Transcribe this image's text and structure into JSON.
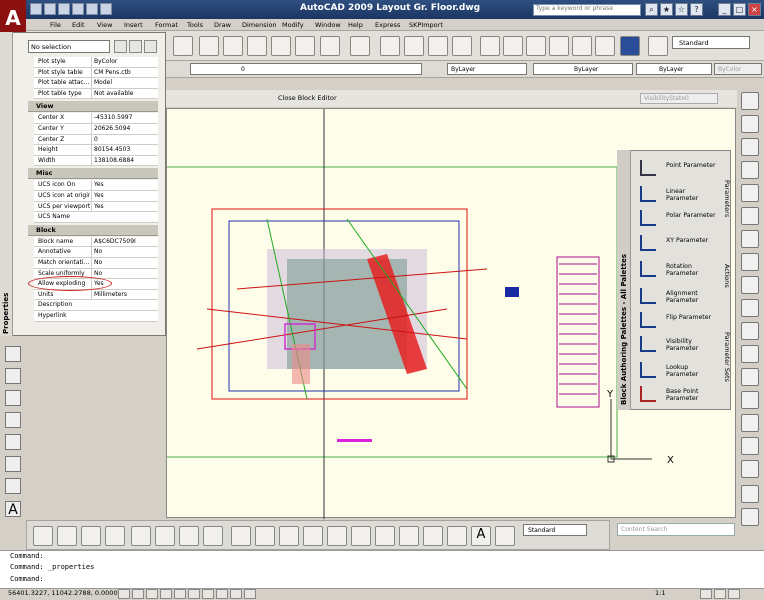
{
  "window": {
    "title": "AutoCAD 2009 Layout Gr. Floor.dwg",
    "search_placeholder": "Type a keyword or phrase"
  },
  "menu": [
    "File",
    "Edit",
    "View",
    "Insert",
    "Format",
    "Tools",
    "Draw",
    "Dimension",
    "Modify",
    "Window",
    "Help",
    "Express",
    "SKPImport"
  ],
  "toolbar": {
    "text_style": "Standard"
  },
  "layers": {
    "layer": "0",
    "color": "ByLayer",
    "linetype": "ByLayer",
    "lineweight": "ByLayer",
    "plotstyle": "ByColor"
  },
  "block_editor": {
    "close_label": "Close Block Editor",
    "visibility_state": "VisibilityState0"
  },
  "properties": {
    "panel_title": "Properties",
    "selection": "No selection",
    "rows_plot": [
      {
        "k": "Plot style",
        "v": "ByColor"
      },
      {
        "k": "Plot style table",
        "v": "CM Pens.ctb"
      },
      {
        "k": "Plot table attac...",
        "v": "Model"
      },
      {
        "k": "Plot table type",
        "v": "Not available"
      }
    ],
    "view_header": "View",
    "rows_view": [
      {
        "k": "Center X",
        "v": "-45310.5997"
      },
      {
        "k": "Center Y",
        "v": "20626.5094"
      },
      {
        "k": "Center Z",
        "v": "0"
      },
      {
        "k": "Height",
        "v": "80154.4503"
      },
      {
        "k": "Width",
        "v": "138108.6884"
      }
    ],
    "misc_header": "Misc",
    "rows_misc": [
      {
        "k": "UCS icon On",
        "v": "Yes"
      },
      {
        "k": "UCS icon at origin",
        "v": "Yes"
      },
      {
        "k": "UCS per viewport",
        "v": "Yes"
      },
      {
        "k": "UCS Name",
        "v": ""
      }
    ],
    "block_header": "Block",
    "rows_block": [
      {
        "k": "Block name",
        "v": "A$C6DC7509I"
      },
      {
        "k": "Annotative",
        "v": "No"
      },
      {
        "k": "Match orientati...",
        "v": "No"
      },
      {
        "k": "Scale uniformly",
        "v": "No"
      },
      {
        "k": "Allow exploding",
        "v": "Yes"
      },
      {
        "k": "Units",
        "v": "Millimeters"
      },
      {
        "k": "Description",
        "v": ""
      },
      {
        "k": "Hyperlink",
        "v": ""
      }
    ]
  },
  "palette": {
    "title": "Block Authoring Palettes - All Palettes",
    "items": [
      "Point Parameter",
      "Linear Parameter",
      "Polar Parameter",
      "XY Parameter",
      "Rotation Parameter",
      "Alignment Parameter",
      "Flip Parameter",
      "Visibility Parameter",
      "Lookup Parameter",
      "Base Point Parameter"
    ],
    "tabs": [
      "Parameters",
      "Actions",
      "Parameter Sets"
    ]
  },
  "bottom": {
    "dim_style": "Standard",
    "content_search": "Content Search"
  },
  "command": {
    "lines": [
      "Command:",
      "Command:  _properties",
      "Command:"
    ]
  },
  "status": {
    "coords": "56401.3227, 11042.2788, 0.0000",
    "scale": "1:1"
  },
  "drawing": {
    "ucs_x": "X",
    "ucs_y": "Y"
  }
}
